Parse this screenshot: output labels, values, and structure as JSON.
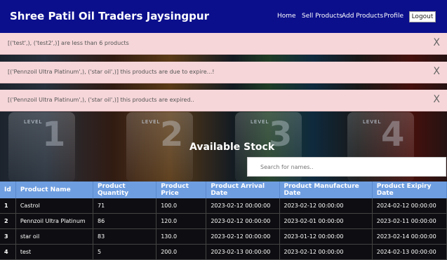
{
  "navbar": {
    "brand": "Shree Patil Oil Traders Jaysingpur",
    "links": [
      "Home",
      "Sell Products",
      "Add Products",
      "Profile"
    ],
    "logout": "Logout"
  },
  "alerts": [
    {
      "message": "[('test',), ('test2',)] are less than 6 products",
      "close": "X"
    },
    {
      "message": "[('Pennzoil Ultra Platinum',), ('star oil',)] this products are due to expire...!",
      "close": "X"
    },
    {
      "message": "[('Pennzoil Ultra Platinum',), ('star oil',)] this products are expired..",
      "close": "X"
    }
  ],
  "banner": {
    "level_label": "LEVEL",
    "levels": [
      "1",
      "2",
      "3",
      "4"
    ]
  },
  "stock": {
    "title": "Available Stock",
    "search_placeholder": "Search for names.."
  },
  "table": {
    "headers": [
      "Id",
      "Product Name",
      "Product Quantity",
      "Product Price",
      "Product Arrival Date",
      "Product Manufacture Date",
      "Product Exipiry Date"
    ],
    "rows": [
      [
        "1",
        "Castrol",
        "71",
        "100.0",
        "2023-02-12 00:00:00",
        "2023-02-12 00:00:00",
        "2024-02-12 00:00:00"
      ],
      [
        "2",
        "Pennzoil Ultra Platinum",
        "86",
        "120.0",
        "2023-02-12 00:00:00",
        "2023-02-01 00:00:00",
        "2023-02-11 00:00:00"
      ],
      [
        "3",
        "star oil",
        "83",
        "130.0",
        "2023-02-12 00:00:00",
        "2023-01-12 00:00:00",
        "2023-02-14 00:00:00"
      ],
      [
        "4",
        "test",
        "5",
        "200.0",
        "2023-02-13 00:00:00",
        "2023-02-12 00:00:00",
        "2024-02-13 00:00:00"
      ]
    ]
  }
}
